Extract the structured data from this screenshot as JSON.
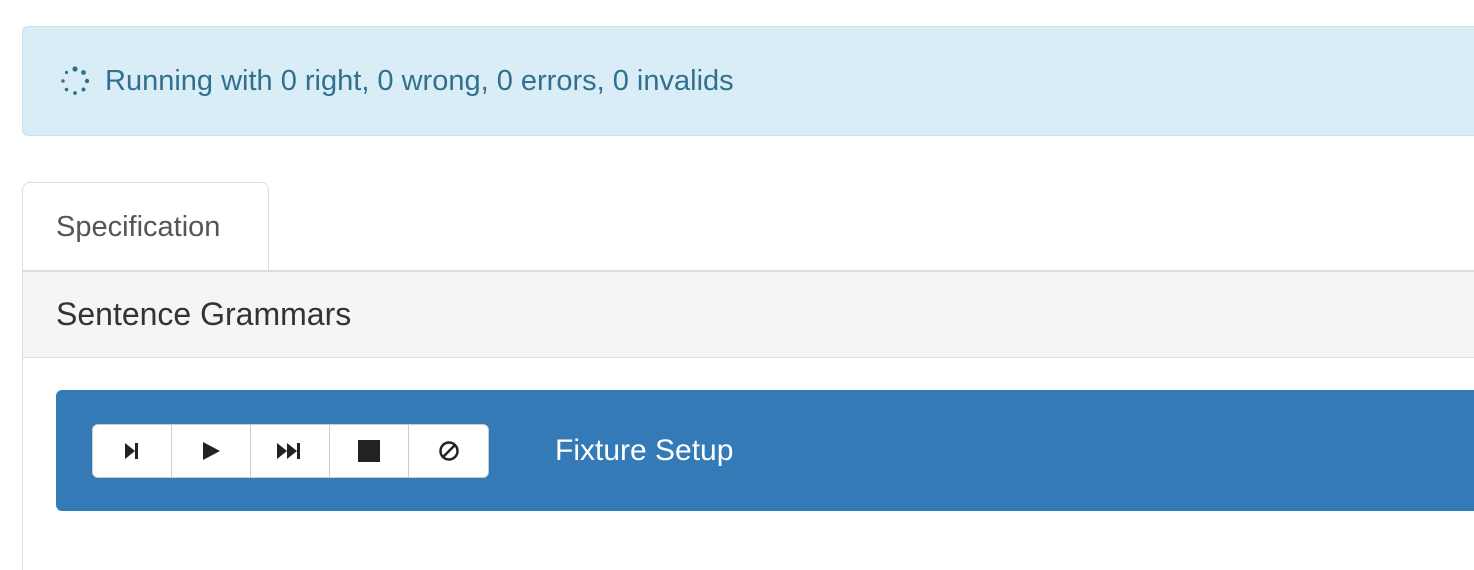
{
  "status": {
    "text": "Running with 0 right, 0 wrong, 0 errors, 0 invalids",
    "icon": "spinner-icon",
    "color": "#31708f",
    "background": "#d9edf7"
  },
  "tabs": [
    {
      "label": "Specification"
    }
  ],
  "panel": {
    "title": "Sentence Grammars"
  },
  "fixture": {
    "title": "Fixture Setup",
    "background": "#337ab7",
    "buttons": [
      {
        "icon": "step-icon"
      },
      {
        "icon": "play-icon"
      },
      {
        "icon": "fast-forward-icon"
      },
      {
        "icon": "stop-icon"
      },
      {
        "icon": "cancel-icon"
      }
    ]
  }
}
